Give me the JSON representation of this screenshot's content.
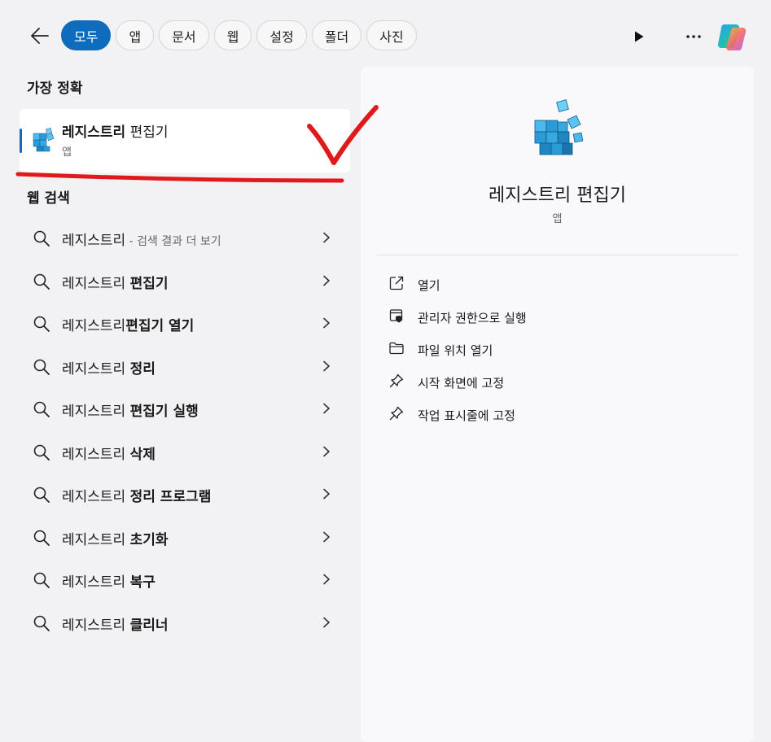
{
  "filters": [
    "모두",
    "앱",
    "문서",
    "웹",
    "설정",
    "폴더",
    "사진"
  ],
  "best_match": {
    "section_title": "가장 정확",
    "name_bold": "레지스트리",
    "name_rest": " 편집기",
    "type": "앱"
  },
  "web_search": {
    "section_title": "웹 검색",
    "items": [
      {
        "prefix": "레지스트리",
        "bold": "",
        "hint": " - 검색 결과 더 보기"
      },
      {
        "prefix": "레지스트리 ",
        "bold": "편집기",
        "hint": ""
      },
      {
        "prefix": "레지스트리",
        "bold": "편집기 열기",
        "hint": ""
      },
      {
        "prefix": "레지스트리 ",
        "bold": "정리",
        "hint": ""
      },
      {
        "prefix": "레지스트리 ",
        "bold": "편집기 실행",
        "hint": ""
      },
      {
        "prefix": "레지스트리 ",
        "bold": "삭제",
        "hint": ""
      },
      {
        "prefix": "레지스트리 ",
        "bold": "정리 프로그램",
        "hint": ""
      },
      {
        "prefix": "레지스트리 ",
        "bold": "초기화",
        "hint": ""
      },
      {
        "prefix": "레지스트리 ",
        "bold": "복구",
        "hint": ""
      },
      {
        "prefix": "레지스트리 ",
        "bold": "클리너",
        "hint": ""
      }
    ]
  },
  "detail": {
    "name": "레지스트리 편집기",
    "type": "앱",
    "actions": [
      {
        "label": "열기",
        "icon": "open-external-icon"
      },
      {
        "label": "관리자 권한으로 실행",
        "icon": "admin-shield-icon"
      },
      {
        "label": "파일 위치 열기",
        "icon": "folder-icon"
      },
      {
        "label": "시작 화면에 고정",
        "icon": "pin-icon"
      },
      {
        "label": "작업 표시줄에 고정",
        "icon": "pin-icon"
      }
    ]
  },
  "colors": {
    "accent": "#0f6cbd",
    "annotation": "#e0191b"
  }
}
